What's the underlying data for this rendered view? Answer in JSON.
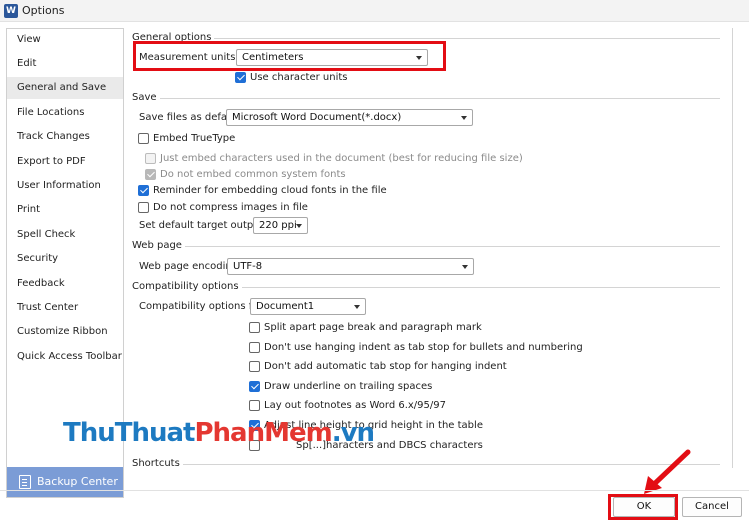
{
  "window": {
    "title": "Options",
    "app_icon_letter": "W"
  },
  "sidebar": {
    "items": [
      {
        "label": "View"
      },
      {
        "label": "Edit"
      },
      {
        "label": "General and Save"
      },
      {
        "label": "File Locations"
      },
      {
        "label": "Track Changes"
      },
      {
        "label": "Export to PDF"
      },
      {
        "label": "User Information"
      },
      {
        "label": "Print"
      },
      {
        "label": "Spell Check"
      },
      {
        "label": "Security"
      },
      {
        "label": "Feedback"
      },
      {
        "label": "Trust Center"
      },
      {
        "label": "Customize Ribbon"
      },
      {
        "label": "Quick Access Toolbar"
      }
    ],
    "selected": "General and Save",
    "backup_label": "Backup Center"
  },
  "general": {
    "title": "General options",
    "measurement_label": "Measurement units:",
    "measurement_value": "Centimeters",
    "use_char_units": "Use character units"
  },
  "save": {
    "title": "Save",
    "save_as_label": "Save files as default:",
    "save_as_value": "Microsoft Word Document(*.docx)",
    "embed_truetype": "Embed TrueType",
    "just_embed": "Just embed characters used in the document (best for reducing file size)",
    "no_common": "Do not embed common system fonts",
    "reminder": "Reminder for embedding cloud fonts in the file",
    "no_compress": "Do not compress images in file",
    "target_label": "Set default target output to:",
    "target_value": "220 ppi"
  },
  "webpage": {
    "title": "Web page",
    "encoding_label": "Web page encoding:",
    "encoding_value": "UTF-8"
  },
  "compat": {
    "title": "Compatibility options",
    "for_label": "Compatibility options for:",
    "for_value": "Document1",
    "options": [
      "Split apart page break and paragraph mark",
      "Don't use hanging indent as tab stop for bullets and numbering",
      "Don't add automatic tab stop for hanging indent",
      "Draw underline on trailing spaces",
      "Lay out footnotes as Word 6.x/95/97",
      "Adjust line height to grid height in the table",
      "Sp[...]haracters and DBCS characters"
    ]
  },
  "shortcuts": {
    "title": "Shortcuts"
  },
  "buttons": {
    "ok": "OK",
    "cancel": "Cancel"
  },
  "watermark": {
    "part1": "ThuThuat",
    "part2": "PhanMem",
    "part3": ".vn"
  },
  "colors": {
    "highlight": "#e30d14",
    "accent": "#1f6fd6",
    "backup_bg": "#7b9cd6"
  }
}
